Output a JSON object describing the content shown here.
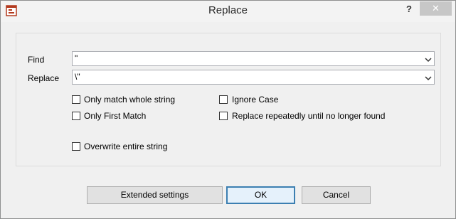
{
  "window": {
    "title": "Replace",
    "help_label": "?",
    "close_label": "✕"
  },
  "find": {
    "label": "Find",
    "value": "\""
  },
  "replace": {
    "label": "Replace",
    "value": "\\\""
  },
  "options": {
    "whole_string": {
      "label": "Only match whole string",
      "checked": false
    },
    "first_match": {
      "label": "Only First Match",
      "checked": false
    },
    "ignore_case": {
      "label": "Ignore Case",
      "checked": false
    },
    "repeat_replace": {
      "label": "Replace repeatedly until no longer found",
      "checked": false
    },
    "overwrite": {
      "label": "Overwrite entire string",
      "checked": false
    }
  },
  "buttons": {
    "extended": "Extended settings",
    "ok": "OK",
    "cancel": "Cancel"
  }
}
